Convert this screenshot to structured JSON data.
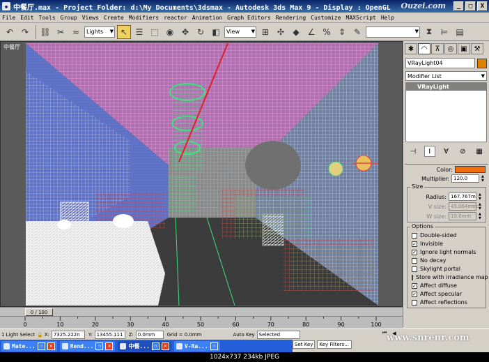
{
  "window": {
    "title": "中餐厅.max    - Project Folder: d:\\My Documents\\3dsmax    - Autodesk 3ds Max 9    - Display : OpenGL",
    "brand": "Ouzei.com",
    "minimize": "_",
    "maximize": "□",
    "close": "X"
  },
  "menu": [
    "File",
    "Edit",
    "Tools",
    "Group",
    "Views",
    "Create",
    "Modifiers",
    "reactor",
    "Animation",
    "Graph Editors",
    "Rendering",
    "Customize",
    "MAXScript",
    "Help"
  ],
  "toolbar": {
    "selection_filter": "Lights",
    "ref_coord": "View",
    "named_sel": ""
  },
  "viewport": {
    "label": "中餐厅"
  },
  "command_panel": {
    "tabs": [
      "create",
      "modify",
      "hierarchy",
      "motion",
      "display",
      "utilities"
    ],
    "object_name": "VRayLight04",
    "modifier_list": "Modifier List",
    "stack_item": "VRayLight",
    "color_label": "Color:",
    "multiplier_label": "Multiplier:",
    "multiplier_value": "120.0",
    "size_title": "Size",
    "radius_label": "Radius:",
    "radius_value": "167.767m",
    "vsize_label": "V size:",
    "vsize_value": "45.064mm",
    "wsize_label": "W size:",
    "wsize_value": "10.0mm",
    "options_title": "Options",
    "options": [
      {
        "label": "Double-sided",
        "checked": false
      },
      {
        "label": "Invisible",
        "checked": true
      },
      {
        "label": "Ignore light normals",
        "checked": true
      },
      {
        "label": "No decay",
        "checked": false
      },
      {
        "label": "Skylight portal",
        "checked": false
      },
      {
        "label": "Store with irradiance map",
        "checked": false
      },
      {
        "label": "Affect diffuse",
        "checked": true
      },
      {
        "label": "Affect specular",
        "checked": true
      },
      {
        "label": "Affect reflections",
        "checked": false
      }
    ],
    "check_mark": "✓",
    "light_color": "#f07010"
  },
  "timeline": {
    "slider_label": "0 / 100",
    "ticks": [
      "0",
      "10",
      "20",
      "30",
      "40",
      "50",
      "60",
      "70",
      "80",
      "90",
      "100"
    ]
  },
  "status": {
    "selection": "1 Light Select",
    "x_label": "X:",
    "x_value": "7325.222n",
    "y_label": "Y:",
    "y_value": "13455.111",
    "z_label": "Z:",
    "z_value": "0.0mm",
    "grid": "Grid = 0.0mm",
    "autokey": "Auto Key",
    "setkey": "Set Key",
    "selected": "Selected",
    "key_filters": "Key Filters..."
  },
  "taskbar": [
    {
      "label": "Mate...",
      "active": false
    },
    {
      "label": "Rend...",
      "active": false
    },
    {
      "label": "中餐...",
      "active": true
    },
    {
      "label": "V-Ra...",
      "active": false
    }
  ],
  "watermark": "www.snrenr.com",
  "caption": "1024x737  234kb  JPEG"
}
